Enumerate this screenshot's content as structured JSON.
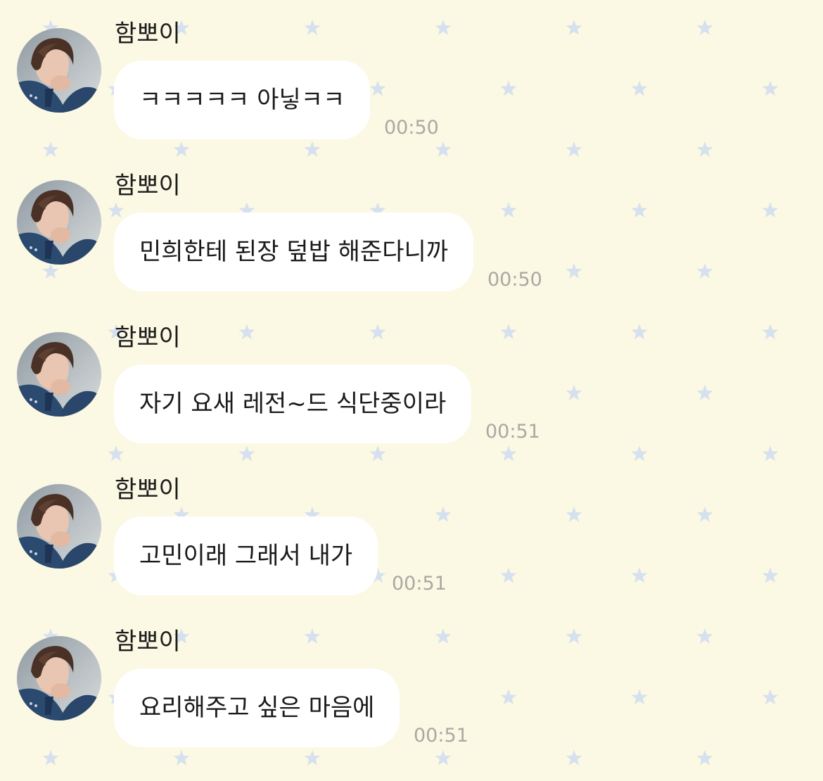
{
  "theme": {
    "background": "#fbf8e3",
    "star_color": "#d6e1ef",
    "bubble_color": "#ffffff",
    "time_color": "#a9a9a4",
    "background_icon": "star-icon"
  },
  "chat": {
    "messages": [
      {
        "sender": "함뽀이",
        "text": "ㅋㅋㅋㅋㅋ 아닣ㅋㅋ",
        "time": "00:50"
      },
      {
        "sender": "함뽀이",
        "text": "민희한테 된장 덮밥 해준다니까",
        "time": "00:50"
      },
      {
        "sender": "함뽀이",
        "text": "자기 요새 레전~드 식단중이라",
        "time": "00:51"
      },
      {
        "sender": "함뽀이",
        "text": "고민이래 그래서 내가",
        "time": "00:51"
      },
      {
        "sender": "함뽀이",
        "text": "요리해주고 싶은 마음에",
        "time": "00:51"
      }
    ]
  }
}
